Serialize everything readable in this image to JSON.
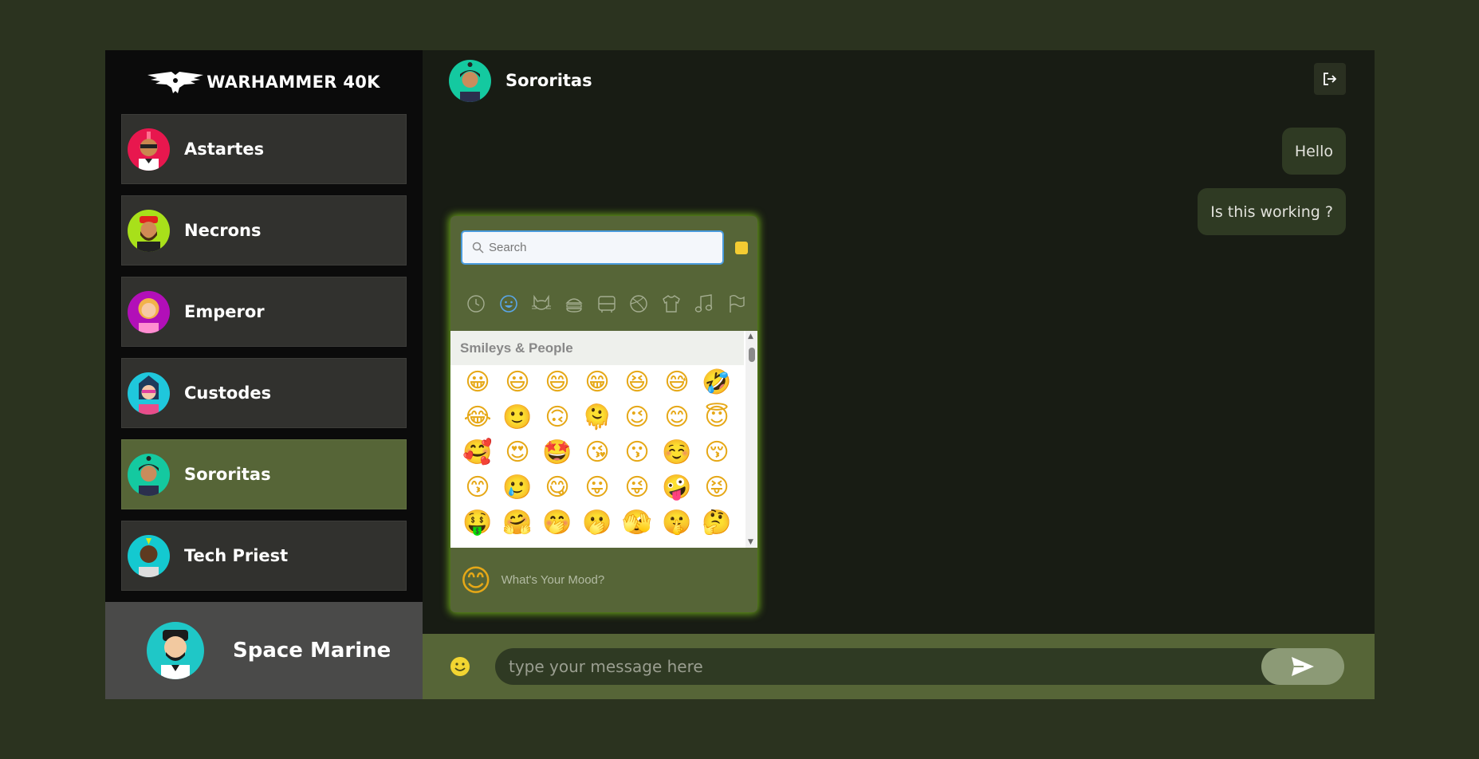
{
  "brand": {
    "title": "WARHAMMER 40K",
    "logo_icon": "imperial-eagle-icon"
  },
  "contacts": [
    {
      "name": "Astartes",
      "avatar_color": "#e8174e",
      "active": false
    },
    {
      "name": "Necrons",
      "avatar_color": "#a8e01a",
      "active": false
    },
    {
      "name": "Emperor",
      "avatar_color": "#b20fb8",
      "active": false
    },
    {
      "name": "Custodes",
      "avatar_color": "#1fc7dc",
      "active": false
    },
    {
      "name": "Sororitas",
      "avatar_color": "#14c9a0",
      "active": true
    },
    {
      "name": "Tech Priest",
      "avatar_color": "#14c9d0",
      "active": false
    }
  ],
  "current_user": {
    "name": "Space Marine",
    "avatar_color": "#1fc7c7"
  },
  "chat": {
    "header_name": "Sororitas",
    "logout_icon": "logout-icon",
    "messages": [
      {
        "text": "Hello"
      },
      {
        "text": "Is this working ?"
      }
    ],
    "input_placeholder": "type your message here",
    "send_icon": "send-icon",
    "emoji_toggle_icon": "smiley-icon"
  },
  "emoji_picker": {
    "search_placeholder": "Search",
    "skin_tone_color": "#f4cc32",
    "categories": [
      "recent-icon",
      "smileys-icon",
      "animals-icon",
      "food-icon",
      "travel-icon",
      "activities-icon",
      "objects-icon",
      "symbols-icon",
      "flags-icon"
    ],
    "section_title": "Smileys & People",
    "emojis": [
      "😀",
      "😃",
      "😄",
      "😁",
      "😆",
      "😅",
      "🤣",
      "😂",
      "🙂",
      "🙃",
      "🫠",
      "😉",
      "😊",
      "😇",
      "🥰",
      "😍",
      "🤩",
      "😘",
      "😗",
      "☺️",
      "😚",
      "😙",
      "🥲",
      "😋",
      "😛",
      "😜",
      "🤪",
      "😝",
      "🤑",
      "🤗",
      "🤭",
      "🫢",
      "🫣",
      "🤫",
      "🤔"
    ],
    "mood_emoji": "😊",
    "mood_label": "What's Your Mood?"
  },
  "colors": {
    "background": "#2b331f",
    "sidebar": "#0b0b0b",
    "contact": "#31312e",
    "active": "#566537",
    "chat": "#181c14",
    "bubble": "#2f3a23"
  }
}
